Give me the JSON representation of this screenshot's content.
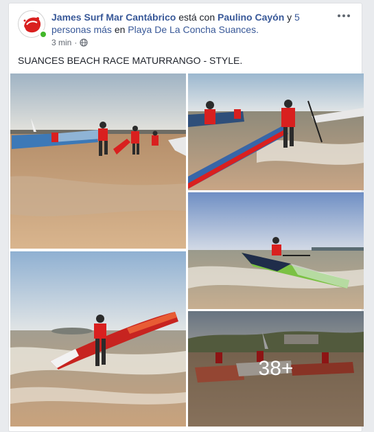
{
  "post": {
    "author": "James Surf Mar Cantábrico",
    "with_text": "está con",
    "tagged_person": "Paulino Cayón",
    "and_text": "y",
    "others_link": "5 personas más",
    "in_text": "en",
    "place": "Playa De La Concha Suances.",
    "time": "3 min",
    "separator": "·",
    "privacy_icon": "globe-icon",
    "caption": "SUANCES BEACH RACE MATURRANGO - STYLE.",
    "more_photos_count": "38+"
  },
  "colors": {
    "link": "#385898",
    "text": "#1d2129",
    "online": "#42b72a"
  }
}
